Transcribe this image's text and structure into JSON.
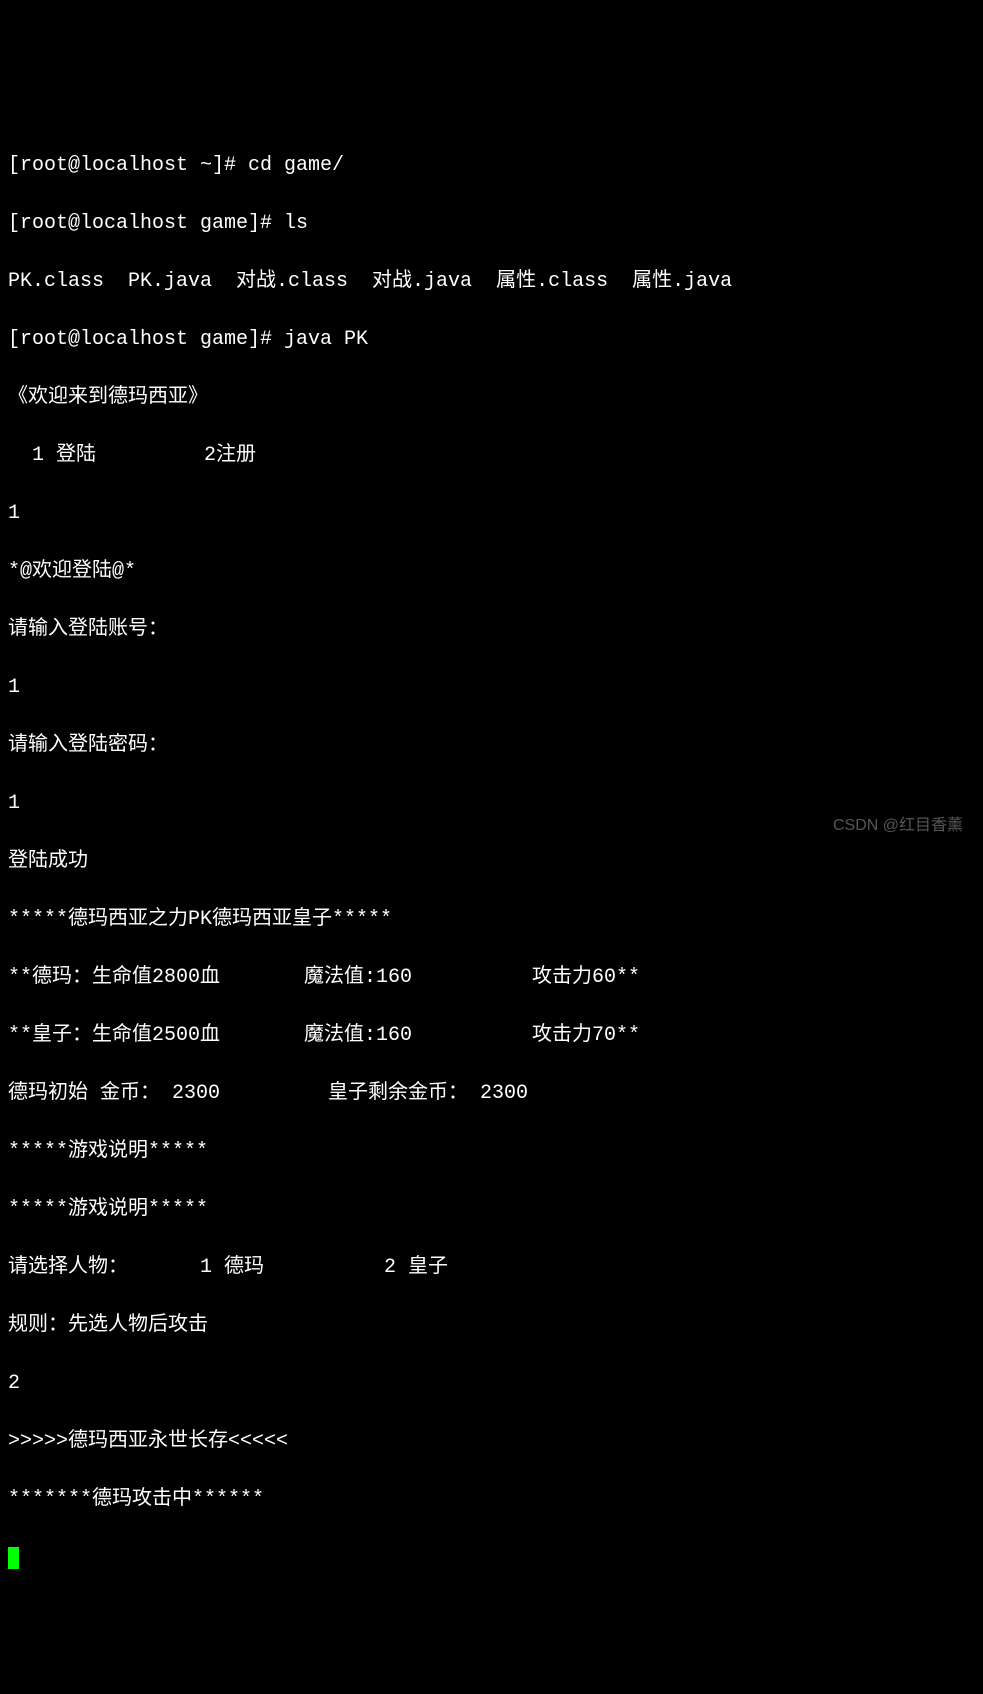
{
  "lines": {
    "l1_prompt": "[root@localhost ~]# ",
    "l1_cmd": "cd game/",
    "l2_prompt": "[root@localhost game]# ",
    "l2_cmd": "ls",
    "l3_files": "PK.class  PK.java  对战.class  对战.java  属性.class  属性.java",
    "l4_prompt": "[root@localhost game]# ",
    "l4_cmd": "java PK",
    "l5": "《欢迎来到德玛西亚》",
    "l6": "  1 登陆         2注册",
    "l7": "1",
    "l8": "*@欢迎登陆@*",
    "l9": "请输入登陆账号：",
    "l10": "1",
    "l11": "请输入登陆密码：",
    "l12": "1",
    "l13": "登陆成功",
    "l14": "*****德玛西亚之力PK德玛西亚皇子*****",
    "l15": "**德玛：生命值2800血       魔法值:160          攻击力60**",
    "l16": "**皇子：生命值2500血       魔法值:160          攻击力70**",
    "l17": "德玛初始 金币： 2300         皇子剩余金币： 2300",
    "l18": "*****游戏说明*****",
    "l19": "*****游戏说明*****",
    "l20": "请选择人物：      1 德玛          2 皇子",
    "l21": "规则：先选人物后攻击",
    "l22": "2",
    "l23": ">>>>>德玛西亚永世长存<<<<<",
    "l24": "*******德玛攻击中******"
  },
  "watermark": "CSDN @红目香薰"
}
